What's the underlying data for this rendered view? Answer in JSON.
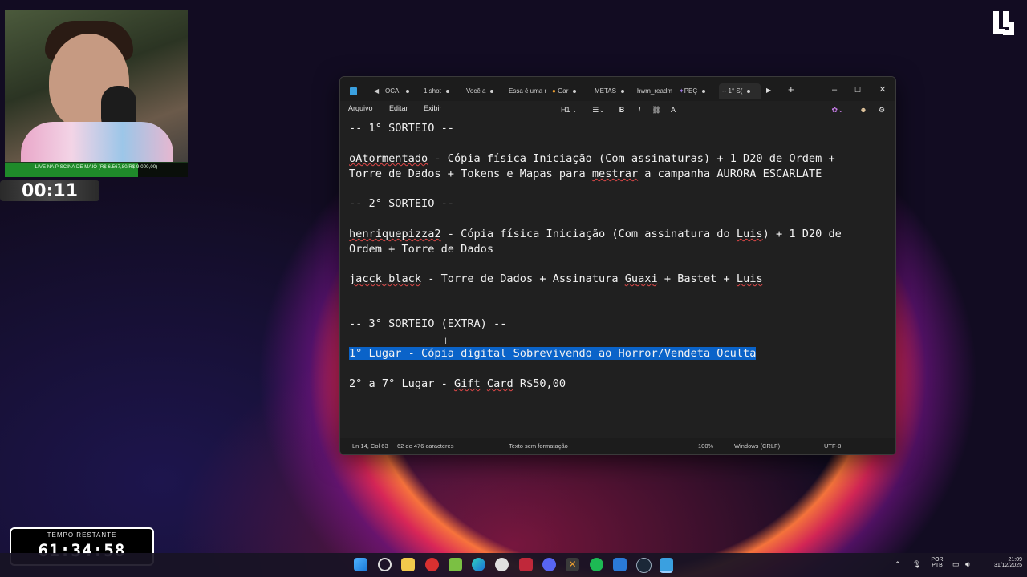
{
  "overlay": {
    "goal_text": "LIVE NA PISCINA DE MAIÔ (R$ 6.567,80/R$ 9.000,00)",
    "goal_progress": 0.73,
    "timer_small": "00:11",
    "countdown_label": "TEMPO RESTANTE",
    "countdown_value": "61:34:58"
  },
  "window": {
    "tabs": [
      "OCAI",
      "1 shot",
      "Você a",
      "Essa é uma r",
      "Gar",
      "METAS",
      "hwm_readm",
      "PEÇ",
      "-- 1° S("
    ],
    "menus": [
      "Arquivo",
      "Editar",
      "Exibir"
    ],
    "heading_label": "H1",
    "lines": [
      "-- 1° SORTEIO --",
      "",
      "oAtormentado - Cópia física Iniciação (Com assinaturas) + 1 D20 de Ordem +",
      "Torre de Dados + Tokens e Mapas para mestrar a campanha AURORA ESCARLATE",
      "",
      "-- 2° SORTEIO --",
      "",
      "henriquepizza2 - Cópia física Iniciação (Com assinatura do Luis) + 1 D20 de",
      "Ordem + Torre de Dados",
      "",
      "jacck_black - Torre de Dados + Assinatura Guaxi + Bastet + Luis",
      "",
      "",
      "-- 3° SORTEIO (EXTRA) --",
      "",
      "1° Lugar - Cópia digital Sobrevivendo ao Horror/Vendeta Oculta",
      "",
      "2° a 7° Lugar - Gift Card R$50,00"
    ],
    "status": {
      "position": "Ln 14, Col 63",
      "chars": "62 de 476 caracteres",
      "format": "Texto sem formatação",
      "zoom": "100%",
      "eol": "Windows (CRLF)",
      "encoding": "UTF-8"
    }
  },
  "taskbar": {
    "lang": "POR",
    "lang2": "PTB",
    "time": "21:09",
    "date": "31/12/2025"
  }
}
